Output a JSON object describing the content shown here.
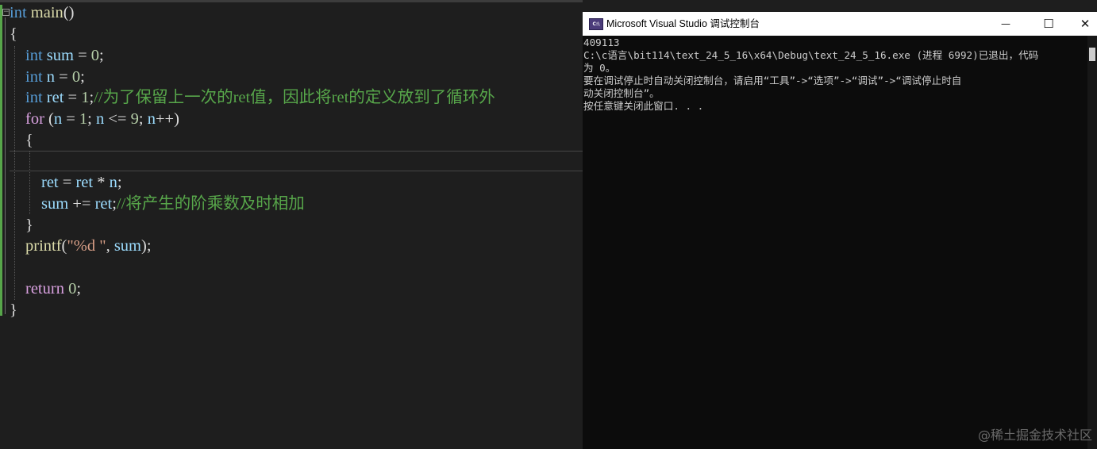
{
  "editor": {
    "line1": {
      "kw": "int",
      "fn": "main",
      "rest": "()"
    },
    "line2": "{",
    "line3": {
      "kw": "int",
      "id": "sum",
      "op": " = ",
      "num": "0",
      "end": ";"
    },
    "line4": {
      "kw": "int",
      "id": "n",
      "op": " = ",
      "num": "0",
      "end": ";"
    },
    "line5": {
      "kw": "int",
      "id": "ret",
      "op": " = ",
      "num": "1",
      "end": ";",
      "comment": "//为了保留上一次的ret值，因此将ret的定义放到了循环外"
    },
    "line6": {
      "kw": "for",
      "p1": " (",
      "id1": "n",
      "op1": " = ",
      "num1": "1",
      "sep1": "; ",
      "id2": "n",
      "op2": " <= ",
      "num2": "9",
      "sep2": "; ",
      "id3": "n",
      "op3": "++)"
    },
    "line7": "{",
    "line9": {
      "id1": "ret",
      "op1": " = ",
      "id2": "ret",
      "op2": " * ",
      "id3": "n",
      "end": ";"
    },
    "line10": {
      "id1": "sum",
      "op1": " += ",
      "id2": "ret",
      "end": ";",
      "comment": "//将产生的阶乘数及时相加"
    },
    "line11": "}",
    "line12": {
      "fn": "printf",
      "p1": "(",
      "str": "\"%d \"",
      "sep": ", ",
      "id": "sum",
      "end": ");"
    },
    "line14": {
      "kw": "return",
      "sp": " ",
      "num": "0",
      "end": ";"
    },
    "line15": "}"
  },
  "console": {
    "title": "Microsoft Visual Studio 调试控制台",
    "icon_label": "C:\\",
    "buttons": {
      "minimize": "—",
      "maximize": "☐",
      "close": "✕"
    },
    "lines": [
      "409113",
      "C:\\c语言\\bit114\\text_24_5_16\\x64\\Debug\\text_24_5_16.exe (进程 6992)已退出，代码",
      "为 0。",
      "要在调试停止时自动关闭控制台，请启用“工具”->“选项”->“调试”->“调试停止时自",
      "动关闭控制台”。",
      "按任意键关闭此窗口. . ."
    ]
  },
  "watermark": "@稀土掘金技术社区",
  "colors": {
    "editor_bg": "#1e1e1e",
    "keyword": "#569cd6",
    "control_keyword": "#d8a0df",
    "identifier": "#9cdcfe",
    "function": "#dcdcaa",
    "number": "#b5cea8",
    "string": "#d69d85",
    "comment": "#57a64a",
    "console_bg": "#0c0c0c",
    "console_text": "#cccccc"
  }
}
